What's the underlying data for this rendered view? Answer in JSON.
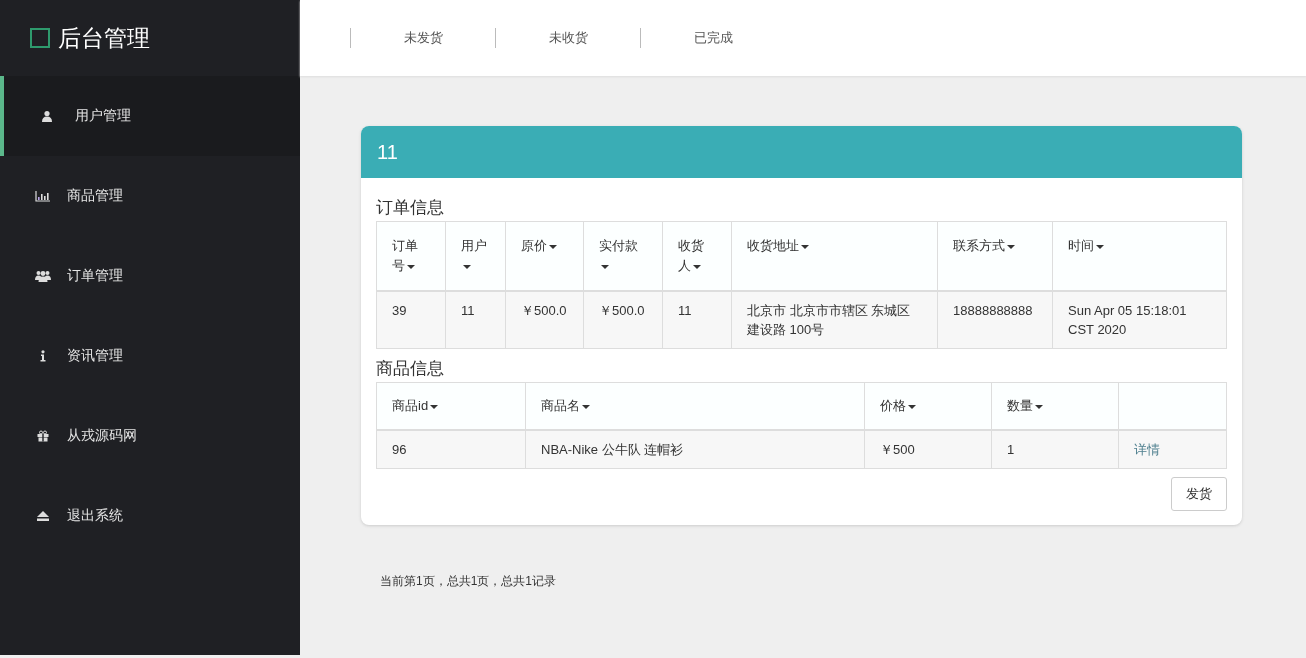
{
  "sidebar": {
    "title": "后台管理",
    "items": [
      {
        "label": "用户管理",
        "selected": true
      },
      {
        "label": "商品管理",
        "selected": false
      },
      {
        "label": "订单管理",
        "selected": false
      },
      {
        "label": "资讯管理",
        "selected": false
      },
      {
        "label": "从戎源码网",
        "selected": false
      },
      {
        "label": "退出系统",
        "selected": false
      }
    ]
  },
  "top_tabs": [
    {
      "label": "未发货"
    },
    {
      "label": "未收货"
    },
    {
      "label": "已完成"
    }
  ],
  "card": {
    "title": "11",
    "order_section": {
      "heading": "订单信息",
      "columns": [
        "订单号",
        "用户",
        "原价",
        "实付款",
        "收货人",
        "收货地址",
        "联系方式",
        "时间"
      ],
      "rows": [
        [
          "39",
          "11",
          "￥500.0",
          "￥500.0",
          "11",
          [
            "北京市 北京市市辖区 东城区",
            "建设路 100号"
          ],
          "18888888888",
          "Sun Apr 05 15:18:01 CST 2020"
        ]
      ]
    },
    "goods_section": {
      "heading": "商品信息",
      "columns": [
        "商品id",
        "商品名",
        "价格",
        "数量"
      ],
      "rows": [
        {
          "cells": [
            "96",
            "NBA-Nike 公牛队 连帽衫",
            "￥500",
            "1"
          ],
          "link": "详情"
        }
      ]
    },
    "button": "发货"
  },
  "pagination": "当前第1页，总共1页，总共1记录"
}
